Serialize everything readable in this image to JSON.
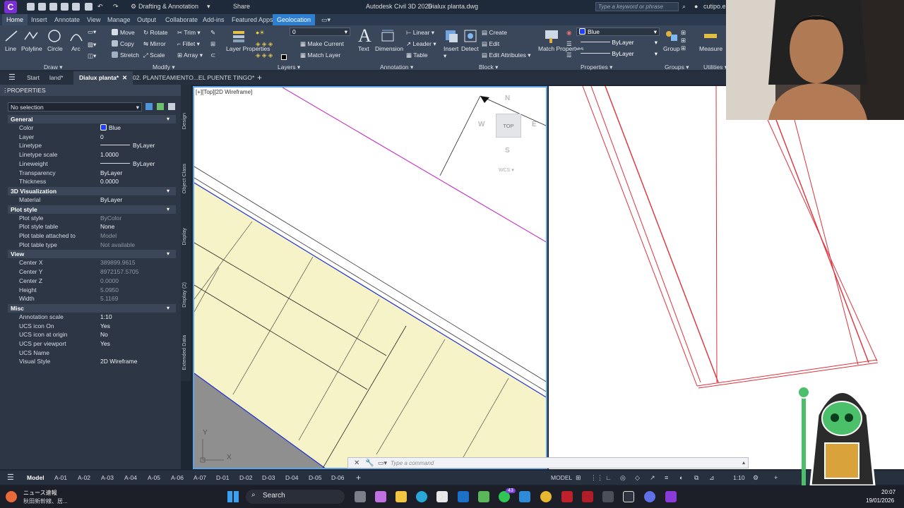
{
  "titlebar": {
    "app_letter": "C",
    "workspace": "Drafting & Annotation",
    "share": "Share",
    "app_title": "Autodesk Civil 3D 2025",
    "file_title": "Dialux planta.dwg",
    "search_placeholder": "Type a keyword or phrase",
    "user": "cutipo.e"
  },
  "ribbon_tabs": [
    "Home",
    "Insert",
    "Annotate",
    "View",
    "Manage",
    "Output",
    "Collaborate",
    "Add-ins",
    "Featured Apps",
    "Geolocation"
  ],
  "ribbon": {
    "draw": {
      "label": "Draw",
      "line": "Line",
      "polyline": "Polyline",
      "circle": "Circle",
      "arc": "Arc"
    },
    "modify": {
      "label": "Modify",
      "move": "Move",
      "rotate": "Rotate",
      "trim": "Trim",
      "copy": "Copy",
      "mirror": "Mirror",
      "fillet": "Fillet",
      "stretch": "Stretch",
      "scale": "Scale",
      "array": "Array"
    },
    "layers": {
      "label": "Layers",
      "layer_properties": "Layer Properties",
      "current_layer": "0",
      "make_current": "Make Current",
      "match_layer": "Match Layer"
    },
    "annotation": {
      "label": "Annotation",
      "text": "Text",
      "dimension": "Dimension",
      "linear": "Linear",
      "leader": "Leader",
      "table": "Table"
    },
    "block": {
      "label": "Block",
      "insert": "Insert",
      "detect": "Detect",
      "create": "Create",
      "edit": "Edit",
      "edit_attributes": "Edit Attributes"
    },
    "properties": {
      "label": "Properties",
      "match_properties": "Match Properties",
      "color": "Blue",
      "linetype": "ByLayer",
      "lineweight": "ByLayer"
    },
    "groups": {
      "label": "Groups",
      "group": "Group"
    },
    "utilities": {
      "label": "Utilities",
      "measure": "Measure"
    }
  },
  "file_tabs": [
    "Start",
    "land*",
    "Dialux planta*",
    "02. PLANTEAMIENTO...EL PUENTE TINGO*"
  ],
  "properties_palette": {
    "title": "PROPERTIES",
    "selection": "No selection",
    "sections": [
      {
        "name": "General",
        "rows": [
          {
            "label": "Color",
            "value": "Blue"
          },
          {
            "label": "Layer",
            "value": "0"
          },
          {
            "label": "Linetype",
            "value": "ByLayer"
          },
          {
            "label": "Linetype scale",
            "value": "1.0000"
          },
          {
            "label": "Lineweight",
            "value": "ByLayer"
          },
          {
            "label": "Transparency",
            "value": "ByLayer"
          },
          {
            "label": "Thickness",
            "value": "0.0000"
          }
        ]
      },
      {
        "name": "3D Visualization",
        "rows": [
          {
            "label": "Material",
            "value": "ByLayer"
          }
        ]
      },
      {
        "name": "Plot style",
        "rows": [
          {
            "label": "Plot style",
            "value": "ByColor"
          },
          {
            "label": "Plot style table",
            "value": "None"
          },
          {
            "label": "Plot table attached to",
            "value": "Model"
          },
          {
            "label": "Plot table type",
            "value": "Not available"
          }
        ]
      },
      {
        "name": "View",
        "rows": [
          {
            "label": "Center X",
            "value": "389899.9615"
          },
          {
            "label": "Center Y",
            "value": "8972157.5705"
          },
          {
            "label": "Center Z",
            "value": "0.0000"
          },
          {
            "label": "Height",
            "value": "5.0950"
          },
          {
            "label": "Width",
            "value": "5.1169"
          }
        ]
      },
      {
        "name": "Misc",
        "rows": [
          {
            "label": "Annotation scale",
            "value": "1:10"
          },
          {
            "label": "UCS icon On",
            "value": "Yes"
          },
          {
            "label": "UCS icon at origin",
            "value": "No"
          },
          {
            "label": "UCS per viewport",
            "value": "Yes"
          },
          {
            "label": "UCS Name",
            "value": ""
          },
          {
            "label": "Visual Style",
            "value": "2D Wireframe"
          }
        ]
      }
    ],
    "side_tabs": [
      "Design",
      "Object Class",
      "Display",
      "Display (2)",
      "Extended Data"
    ]
  },
  "viewport": {
    "label": "[+][Top][2D Wireframe]",
    "viewcube": {
      "face": "TOP",
      "north": "N",
      "south": "S",
      "east": "E",
      "west": "W",
      "ucs": "WCS"
    },
    "ucs_y": "Y",
    "ucs_x": "X"
  },
  "command": {
    "placeholder": "Type a command"
  },
  "layout_tabs": [
    "Model",
    "A-01",
    "A-02",
    "A-03",
    "A-04",
    "A-05",
    "A-06",
    "A-07",
    "D-01",
    "D-02",
    "D-03",
    "D-04",
    "D-05",
    "D-06"
  ],
  "status": {
    "model": "MODEL",
    "scale": "1:10"
  },
  "taskbar": {
    "news_line1": "ニュース速報",
    "news_line2": "秋田新幹線、居...",
    "search": "Search",
    "badge_count": "43",
    "time": "20:07",
    "date": "19/01/2026"
  },
  "colors": {
    "accent": "#2f7fd0",
    "magenta": "#c020c0",
    "red": "#e0303a",
    "fill": "#f7f3c8"
  }
}
